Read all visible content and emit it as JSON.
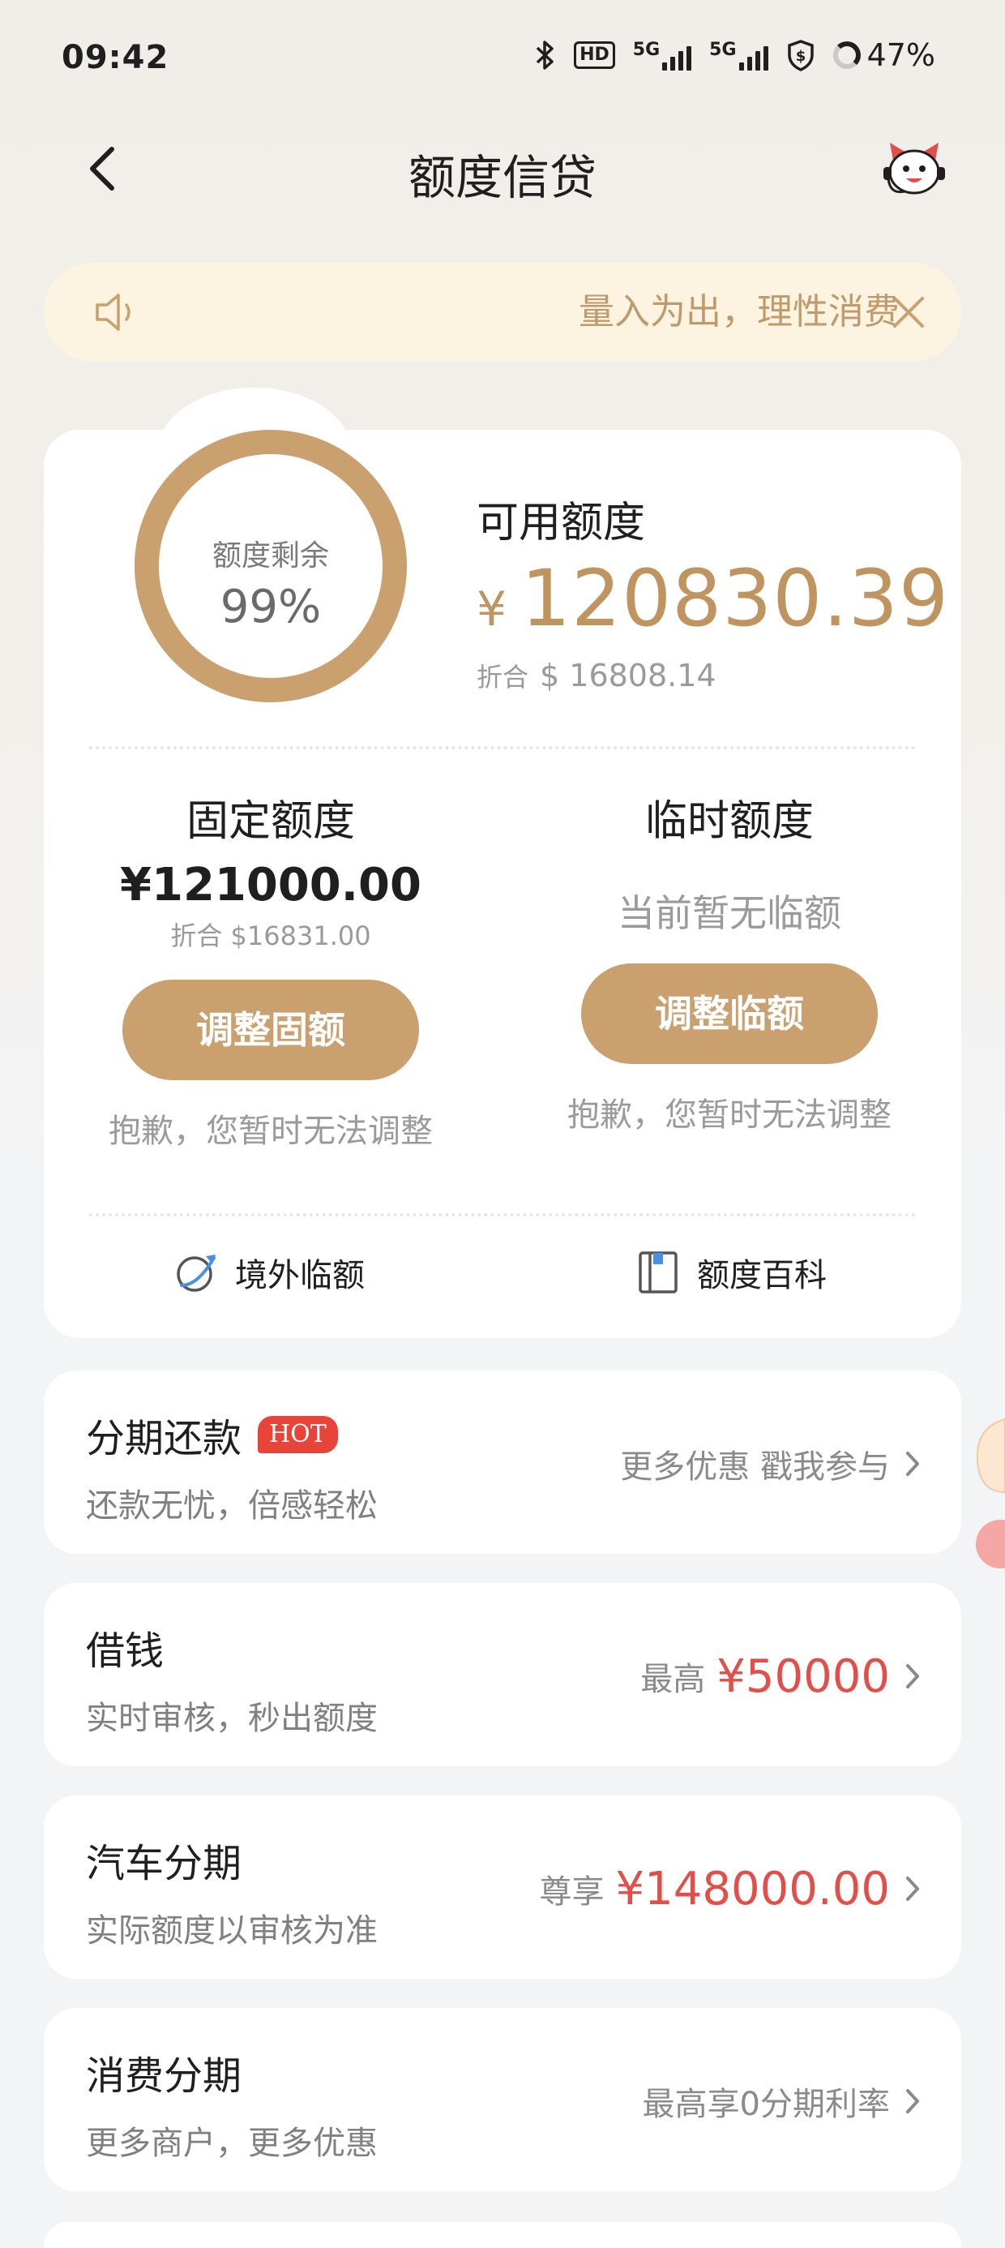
{
  "status": {
    "time": "09:42",
    "hd": "HD",
    "net1": "5G",
    "net2": "5G",
    "battery": "47%"
  },
  "nav": {
    "title": "额度信贷"
  },
  "notice": {
    "text": "量入为出，理性消费"
  },
  "credit": {
    "ring_label": "额度剩余",
    "ring_percent": "99%",
    "ring_fraction": 0.99,
    "available_label": "可用额度",
    "currency": "¥",
    "available_amount": "120830.39",
    "usd_label": "折合",
    "usd_amount": "$ 16808.14",
    "fixed": {
      "title": "固定额度",
      "amount": "¥121000.00",
      "usd": "折合 $16831.00",
      "button": "调整固额",
      "note": "抱歉，您暂时无法调整"
    },
    "temp": {
      "title": "临时额度",
      "status": "当前暂无临额",
      "button": "调整临额",
      "note": "抱歉，您暂时无法调整"
    },
    "links": {
      "overseas": "境外临额",
      "wiki": "额度百科"
    }
  },
  "list": [
    {
      "title": "分期还款",
      "badge": "HOT",
      "subtitle": "还款无忧，倍感轻松",
      "right_text": "更多优惠 戳我参与"
    },
    {
      "title": "借钱",
      "subtitle": "实时审核，秒出额度",
      "right_prefix": "最高",
      "right_value": "¥50000"
    },
    {
      "title": "汽车分期",
      "subtitle": "实际额度以审核为准",
      "right_prefix": "尊享",
      "right_value": "¥148000.00"
    },
    {
      "title": "消费分期",
      "subtitle": "更多商户，更多优惠",
      "right_text": "最高享0分期利率"
    }
  ],
  "colors": {
    "gold": "#c9a06e",
    "gold_text": "#c0945f",
    "red": "#e24f48",
    "notice_bg": "#fcf3e1"
  }
}
